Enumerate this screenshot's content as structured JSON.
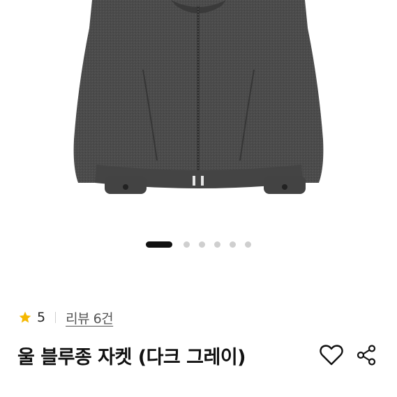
{
  "product": {
    "image_alt": "charcoal wool zip-up blouson jacket",
    "image_colors": {
      "fabric": "#4a4a4a",
      "shadow": "#333333",
      "zipper": "#e6e6e6"
    },
    "carousel": {
      "total_slides": 6,
      "active_index": 0
    },
    "rating": {
      "value": "5",
      "star_color": "#f5b800",
      "icon": "star-icon"
    },
    "review_link": "리뷰 6건",
    "title": "울 블루종 자켓 (다크 그레이)",
    "actions": [
      {
        "icon": "heart-icon"
      },
      {
        "icon": "share-icon"
      }
    ]
  }
}
